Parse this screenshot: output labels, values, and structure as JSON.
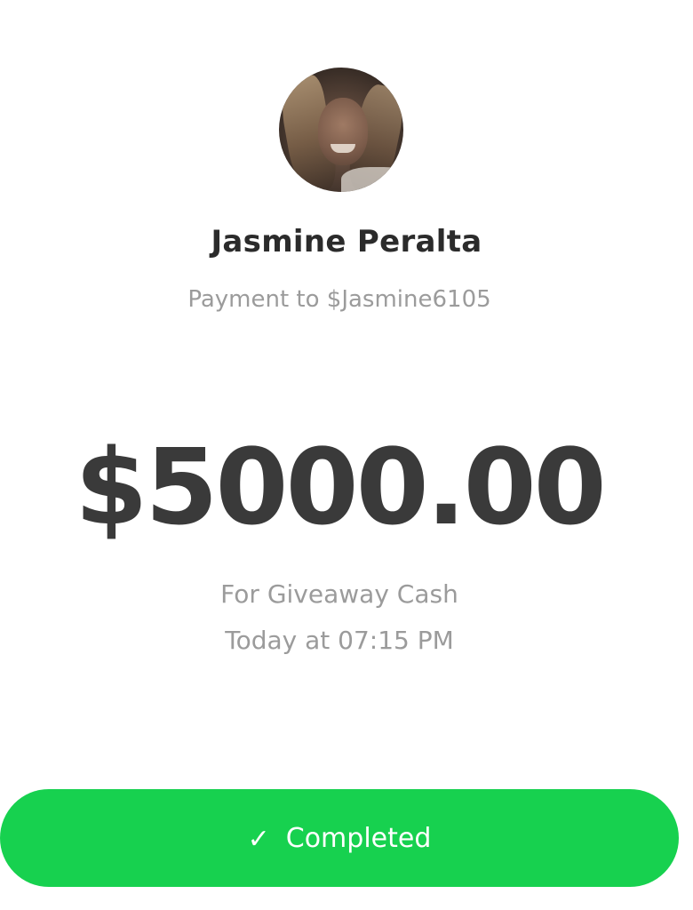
{
  "recipient": {
    "name": "Jasmine Peralta",
    "payment_line": "Payment to $Jasmine6105"
  },
  "payment": {
    "amount": "$5000.00",
    "note": "For Giveaway Cash",
    "time": "Today at 07:15 PM"
  },
  "status": {
    "icon": "check-icon",
    "label": "Completed",
    "color": "#17d14f"
  }
}
